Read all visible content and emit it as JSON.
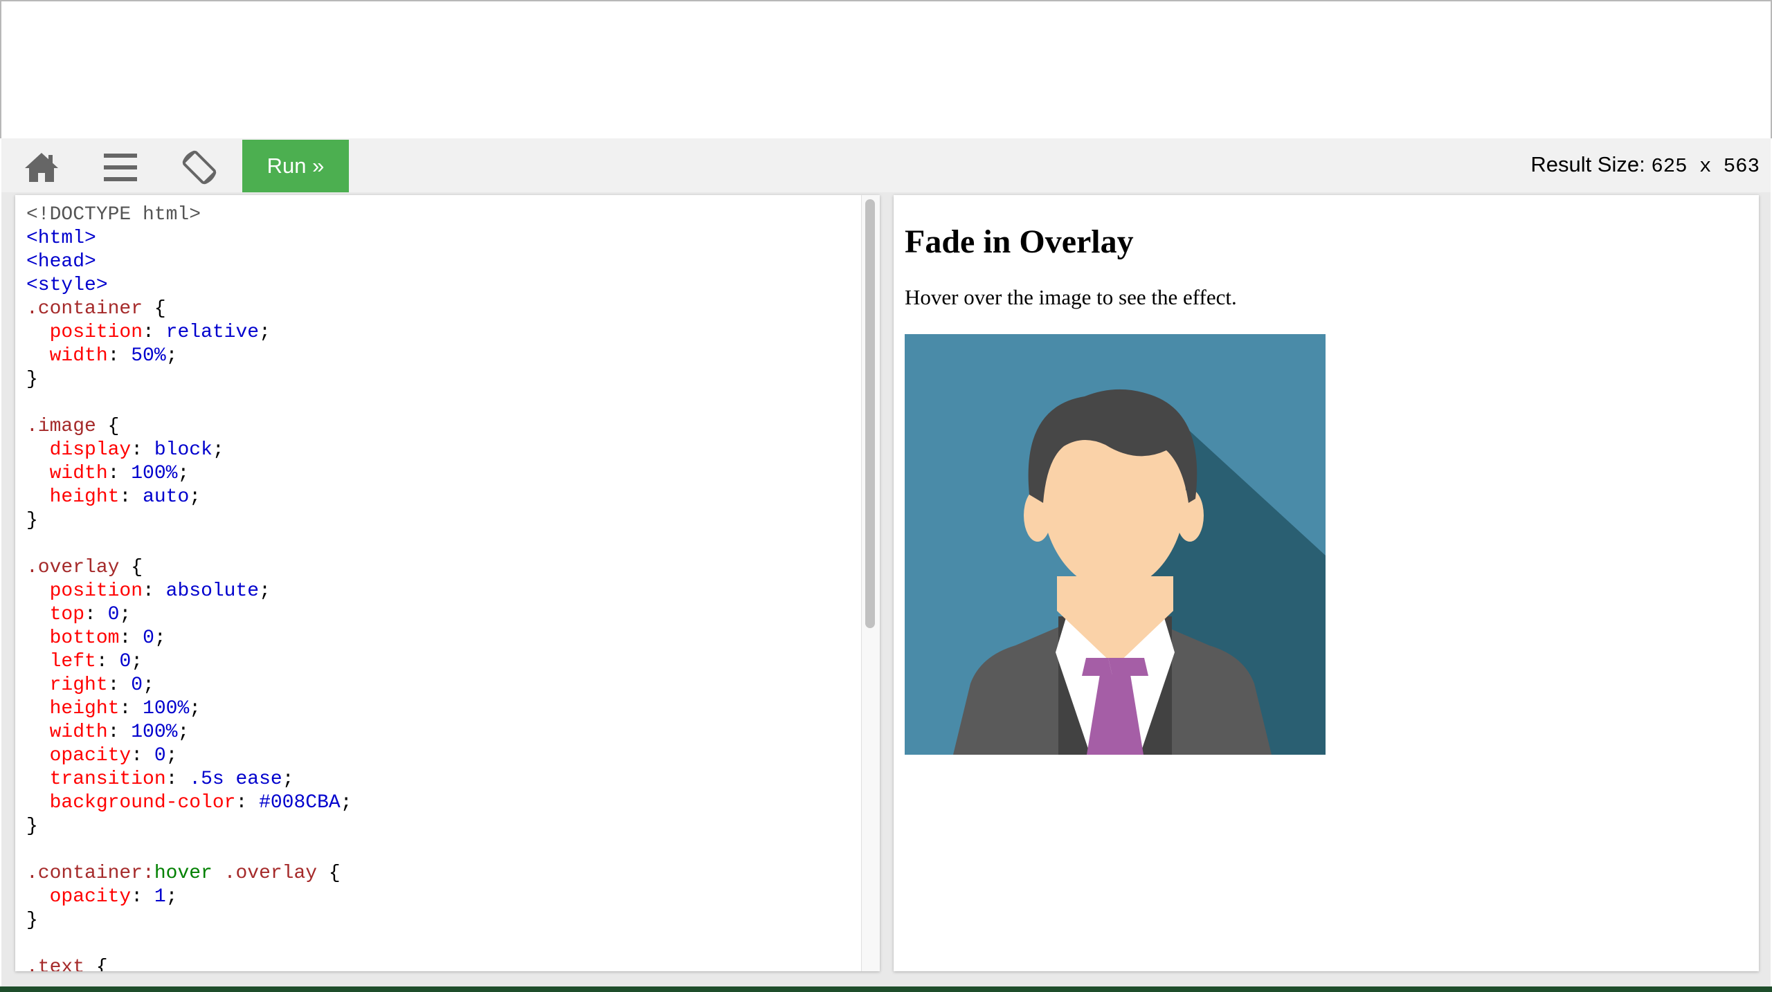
{
  "toolbar": {
    "home_icon": "home-icon",
    "menu_icon": "menu-icon",
    "rotate_icon": "rotate-icon",
    "run_label": "Run »",
    "result_size_label": "Result Size:",
    "result_size_value": "625 x 563"
  },
  "code_lines": [
    "<!DOCTYPE html>",
    "<html>",
    "<head>",
    "<style>",
    ".container {",
    "  position: relative;",
    "  width: 50%;",
    "}",
    "",
    ".image {",
    "  display: block;",
    "  width: 100%;",
    "  height: auto;",
    "}",
    "",
    ".overlay {",
    "  position: absolute;",
    "  top: 0;",
    "  bottom: 0;",
    "  left: 0;",
    "  right: 0;",
    "  height: 100%;",
    "  width: 100%;",
    "  opacity: 0;",
    "  transition: .5s ease;",
    "  background-color: #008CBA;",
    "}",
    "",
    ".container:hover .overlay {",
    "  opacity: 1;",
    "}",
    "",
    ".text {"
  ],
  "result": {
    "heading": "Fade in Overlay",
    "description": "Hover over the image to see the effect."
  },
  "colors": {
    "run_button": "#4CAF50",
    "toolbar_bg": "#F1F1F1",
    "avatar_bg": "#4A8BA8",
    "avatar_shadow": "#2A5F72",
    "suit": "#5A5A5A",
    "hair": "#474747",
    "skin": "#FAD2A8",
    "tie": "#A55EA6"
  }
}
